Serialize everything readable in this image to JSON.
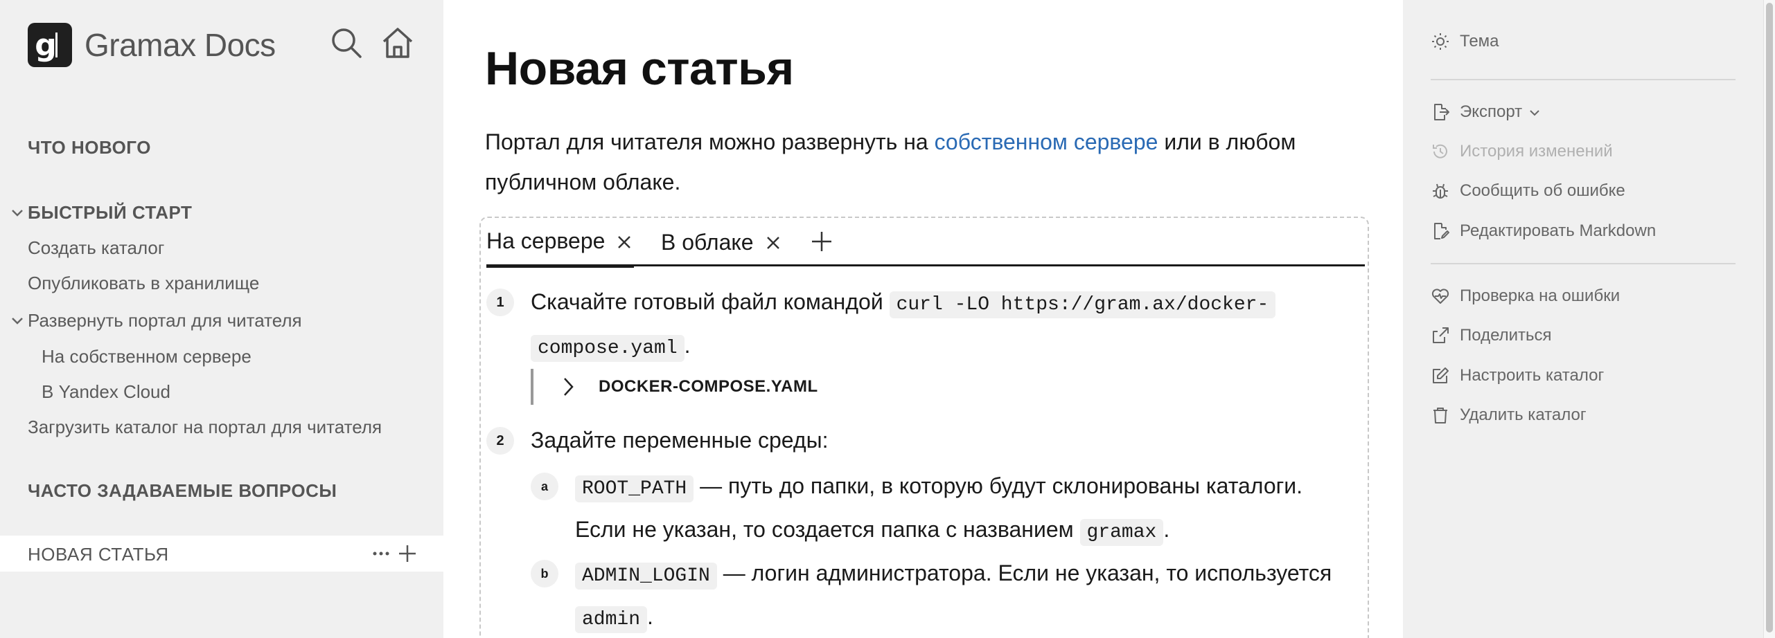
{
  "app": {
    "logo_letter": "g",
    "title": "Gramax Docs"
  },
  "sidebar": {
    "whats_new": "ЧТО НОВОГО",
    "quick_start": "БЫСТРЫЙ СТАРТ",
    "items": [
      {
        "label": "Создать каталог"
      },
      {
        "label": "Опубликовать в хранилище"
      },
      {
        "label": "Развернуть портал для читателя"
      },
      {
        "label": "На собственном сервере"
      },
      {
        "label": "В Yandex Cloud"
      },
      {
        "label": "Загрузить каталог на портал для читателя"
      }
    ],
    "faq": "ЧАСТО ЗАДАВАЕМЫЕ ВОПРОСЫ",
    "active": "НОВАЯ СТАТЬЯ"
  },
  "main": {
    "title": "Новая статья",
    "intro_before": "Портал для читателя можно развернуть на ",
    "intro_link": "собственном сервере",
    "intro_after": " или в любом публичном облаке.",
    "tabs": [
      {
        "label": "На сервере"
      },
      {
        "label": "В облаке"
      }
    ],
    "step1": {
      "num": "1",
      "text": "Скачайте готовый файл командой ",
      "code_a": "curl -LO https://gram.ax/docker-",
      "code_b": "compose.yaml",
      "end": ".",
      "collapse_title": "DOCKER-COMPOSE.YAML"
    },
    "step2": {
      "num": "2",
      "text": "Задайте переменные среды:"
    },
    "sub_a": {
      "letter": "a",
      "code": "ROOT_PATH",
      "text": " — путь до папки, в которую будут склонированы каталоги.",
      "line2": "Если не указан, то создается папка с названием ",
      "code2": "gramax",
      "end": "."
    },
    "sub_b": {
      "letter": "b",
      "code": "ADMIN_LOGIN",
      "text": " — логин администратора. Если не указан, то используется",
      "code2": "admin",
      "end": "."
    }
  },
  "right_panel": {
    "theme": "Тема",
    "export": "Экспорт",
    "history": "История изменений",
    "report": "Сообщить об ошибке",
    "edit_md": "Редактировать Markdown",
    "check": "Проверка на ошибки",
    "share": "Поделиться",
    "configure": "Настроить каталог",
    "delete": "Удалить каталог"
  },
  "colors": {
    "link": "#2a6ab4",
    "sidebar_bg": "#f0f0f0",
    "logo_bg": "#1f1f1f"
  }
}
